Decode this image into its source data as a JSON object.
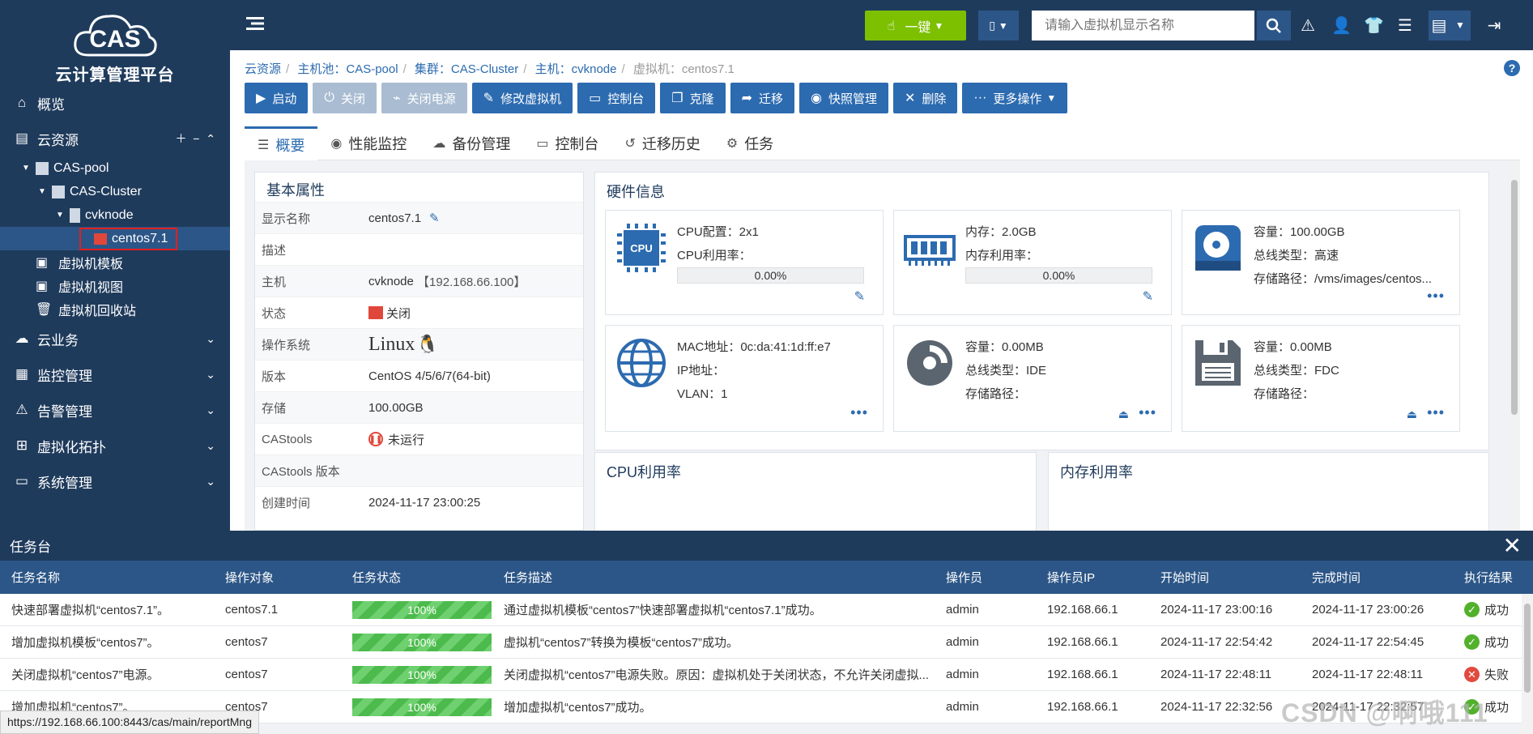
{
  "app": {
    "logo_text": "CAS",
    "name": "云计算管理平台"
  },
  "sidebar": {
    "overview": "概览",
    "cloud_resources": "云资源",
    "tree": {
      "pool": "CAS-pool",
      "cluster": "CAS-Cluster",
      "host": "cvknode",
      "vm": "centos7.1"
    },
    "vm_template": "虚拟机模板",
    "vm_view": "虚拟机视图",
    "vm_recycle": "虚拟机回收站",
    "cloud_business": "云业务",
    "monitor": "监控管理",
    "alarm": "告警管理",
    "topology": "虚拟化拓扑",
    "system": "系统管理"
  },
  "topbar": {
    "onekey": "一键",
    "search_placeholder": "请输入虚拟机显示名称"
  },
  "breadcrumb": {
    "c1": "云资源",
    "c2": "主机池：CAS-pool",
    "c3": "集群：CAS-Cluster",
    "c4": "主机：cvknode",
    "c5": "虚拟机：centos7.1"
  },
  "toolbar": {
    "start": "启动",
    "shutdown": "关闭",
    "poweroff": "关闭电源",
    "modify": "修改虚拟机",
    "console": "控制台",
    "clone": "克隆",
    "migrate": "迁移",
    "snapshot": "快照管理",
    "delete": "删除",
    "more": "更多操作"
  },
  "tabs": {
    "overview": "概要",
    "perf": "性能监控",
    "backup": "备份管理",
    "console": "控制台",
    "migrate_history": "迁移历史",
    "task": "任务"
  },
  "basic": {
    "title": "基本属性",
    "display_name_k": "显示名称",
    "display_name_v": "centos7.1",
    "desc_k": "描述",
    "host_k": "主机",
    "host_v": "cvknode",
    "host_ip": "【192.168.66.100】",
    "state_k": "状态",
    "state_v": "关闭",
    "os_k": "操作系统",
    "os_v": "Linux",
    "version_k": "版本",
    "version_v": "CentOS 4/5/6/7(64-bit)",
    "storage_k": "存储",
    "storage_v": "100.00GB",
    "castools_k": "CAStools",
    "castools_v": "未运行",
    "castools_ver_k": "CAStools 版本",
    "created_k": "创建时间",
    "created_v": "2024-11-17 23:00:25"
  },
  "hardware": {
    "title": "硬件信息",
    "cpu": {
      "label": "CPU",
      "config": "CPU配置：2x1",
      "usage_label": "CPU利用率：",
      "usage": "0.00%"
    },
    "mem": {
      "size": "内存：2.0GB",
      "usage_label": "内存利用率：",
      "usage": "0.00%"
    },
    "disk": {
      "capacity": "容量：100.00GB",
      "bus": "总线类型：高速",
      "path": "存储路径：/vms/images/centos..."
    },
    "net": {
      "mac": "MAC地址：0c:da:41:1d:ff:e7",
      "ip": "IP地址：",
      "vlan": "VLAN：1"
    },
    "cd": {
      "capacity": "容量：0.00MB",
      "bus": "总线类型：IDE",
      "path": "存储路径："
    },
    "floppy": {
      "capacity": "容量：0.00MB",
      "bus": "总线类型：FDC",
      "path": "存储路径："
    }
  },
  "charts": {
    "cpu_title": "CPU利用率",
    "mem_title": "内存利用率"
  },
  "tasks": {
    "title": "任务台",
    "headers": [
      "任务名称",
      "操作对象",
      "任务状态",
      "任务描述",
      "操作员",
      "操作员IP",
      "开始时间",
      "完成时间",
      "执行结果"
    ],
    "rows": [
      {
        "name": "快速部署虚拟机“centos7.1”。",
        "object": "centos7.1",
        "progress": "100%",
        "desc": "通过虚拟机模板“centos7”快速部署虚拟机“centos7.1”成功。",
        "operator": "admin",
        "ip": "192.168.66.1",
        "start": "2024-11-17 23:00:16",
        "end": "2024-11-17 23:00:26",
        "result": "成功"
      },
      {
        "name": "增加虚拟机模板“centos7”。",
        "object": "centos7",
        "progress": "100%",
        "desc": "虚拟机“centos7”转换为模板“centos7”成功。",
        "operator": "admin",
        "ip": "192.168.66.1",
        "start": "2024-11-17 22:54:42",
        "end": "2024-11-17 22:54:45",
        "result": "成功"
      },
      {
        "name": "关闭虚拟机“centos7”电源。",
        "object": "centos7",
        "progress": "100%",
        "desc": "关闭虚拟机“centos7”电源失败。原因：虚拟机处于关闭状态，不允许关闭虚拟...",
        "operator": "admin",
        "ip": "192.168.66.1",
        "start": "2024-11-17 22:48:11",
        "end": "2024-11-17 22:48:11",
        "result": "失败"
      },
      {
        "name": "增加虚拟机“centos7”。",
        "object": "centos7",
        "progress": "100%",
        "desc": "增加虚拟机“centos7”成功。",
        "operator": "admin",
        "ip": "192.168.66.1",
        "start": "2024-11-17 22:32:56",
        "end": "2024-11-17 22:32:57",
        "result": "成功"
      }
    ]
  },
  "status_url": "https://192.168.66.100:8443/cas/main/reportMng",
  "watermark": "CSDN @啊哦111"
}
